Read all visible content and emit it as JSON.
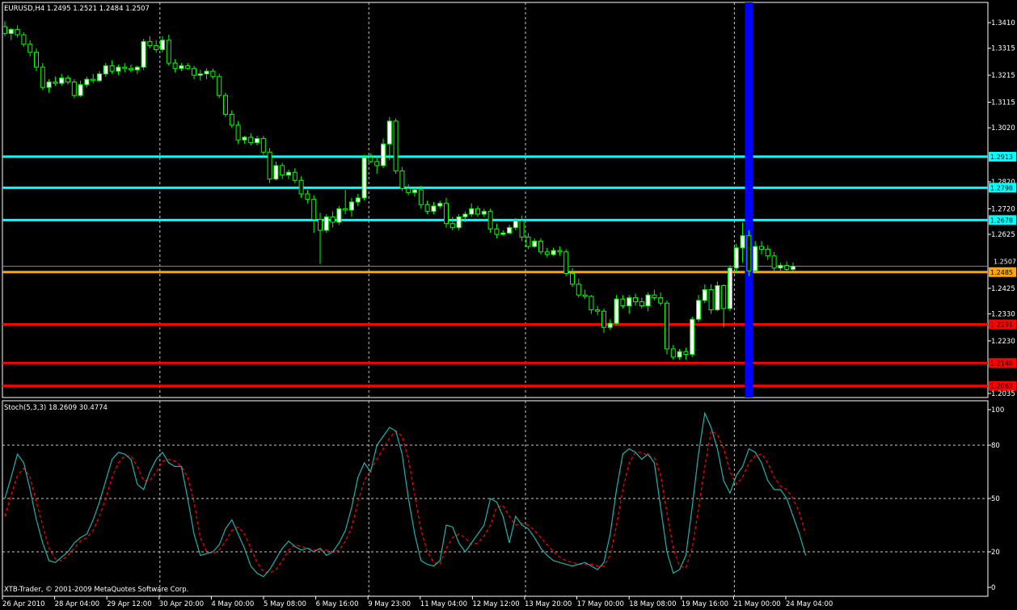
{
  "window": {
    "symbol_title": "EURUSD,H4  1.2495 1.2521 1.2484 1.2507",
    "footer": "XTB-Trader, © 2001-2009 MetaQuotes Software Corp."
  },
  "colors": {
    "background": "#000000",
    "candle_up": "#ffffff",
    "candle_down": "#000000",
    "candle_wick": "#00ff00",
    "grid": "#c8c8c8",
    "resistance": "#00ffff",
    "current": "#ffa500",
    "support": "#ff0000",
    "marker": "#0000ff",
    "stoch_main": "#20b2aa",
    "stoch_signal": "#ff0000"
  },
  "price_axis": {
    "ticks": [
      "1.3410",
      "1.3315",
      "1.3215",
      "1.3115",
      "1.3020",
      "1.2820",
      "1.2720",
      "1.2625",
      "1.2425",
      "1.2330",
      "1.2230",
      "1.2035"
    ],
    "tick_values": [
      1.341,
      1.3315,
      1.3215,
      1.3115,
      1.302,
      1.282,
      1.272,
      1.2625,
      1.2425,
      1.233,
      1.223,
      1.2035
    ],
    "current_label": "1.2507",
    "range": [
      1.202,
      1.3485
    ]
  },
  "levels": [
    {
      "value": 1.2913,
      "label": "1.2913",
      "kind": "resistance"
    },
    {
      "value": 1.2798,
      "label": "1.2798",
      "kind": "resistance"
    },
    {
      "value": 1.2678,
      "label": "1.2678",
      "kind": "resistance"
    },
    {
      "value": 1.2485,
      "label": "1.2485",
      "kind": "current"
    },
    {
      "value": 1.2291,
      "label": "1.2291",
      "kind": "support"
    },
    {
      "value": 1.2148,
      "label": "1.2148",
      "kind": "support"
    },
    {
      "value": 1.2063,
      "label": "1.2063",
      "kind": "support"
    }
  ],
  "time_axis": {
    "labels": [
      "26 Apr 2010",
      "28 Apr 04:00",
      "29 Apr 12:00",
      "30 Apr 20:00",
      "4 May 00:00",
      "5 May 08:00",
      "6 May 16:00",
      "9 May 23:00",
      "11 May 04:00",
      "12 May 12:00",
      "13 May 20:00",
      "17 May 00:00",
      "18 May 08:00",
      "19 May 16:00",
      "21 May 00:00",
      "24 May 04:00"
    ],
    "vertical_grid_at_label": [
      3,
      7,
      10,
      14
    ]
  },
  "marker_bar_index": 118,
  "chart_data": {
    "type": "candlestick",
    "timeframe": "H4",
    "ohlc": [
      [
        1.3395,
        1.3415,
        1.336,
        1.337
      ],
      [
        1.337,
        1.339,
        1.3345,
        1.3385
      ],
      [
        1.3385,
        1.34,
        1.3355,
        1.3365
      ],
      [
        1.3365,
        1.3375,
        1.332,
        1.333
      ],
      [
        1.333,
        1.3345,
        1.3285,
        1.33
      ],
      [
        1.33,
        1.3315,
        1.323,
        1.3245
      ],
      [
        1.3245,
        1.326,
        1.316,
        1.317
      ],
      [
        1.317,
        1.32,
        1.315,
        1.319
      ],
      [
        1.319,
        1.321,
        1.3175,
        1.3185
      ],
      [
        1.3185,
        1.322,
        1.3175,
        1.3205
      ],
      [
        1.3205,
        1.3215,
        1.318,
        1.319
      ],
      [
        1.319,
        1.32,
        1.313,
        1.314
      ],
      [
        1.314,
        1.3195,
        1.3135,
        1.318
      ],
      [
        1.318,
        1.321,
        1.317,
        1.32
      ],
      [
        1.32,
        1.322,
        1.3185,
        1.3195
      ],
      [
        1.3195,
        1.323,
        1.319,
        1.322
      ],
      [
        1.322,
        1.326,
        1.321,
        1.325
      ],
      [
        1.325,
        1.327,
        1.322,
        1.323
      ],
      [
        1.323,
        1.3255,
        1.3215,
        1.3245
      ],
      [
        1.3245,
        1.326,
        1.3225,
        1.324
      ],
      [
        1.324,
        1.3255,
        1.3225,
        1.3235
      ],
      [
        1.3235,
        1.325,
        1.322,
        1.3245
      ],
      [
        1.3245,
        1.335,
        1.3235,
        1.334
      ],
      [
        1.334,
        1.336,
        1.3315,
        1.3325
      ],
      [
        1.3325,
        1.3345,
        1.33,
        1.331
      ],
      [
        1.331,
        1.336,
        1.33,
        1.3345
      ],
      [
        1.3345,
        1.3365,
        1.325,
        1.326
      ],
      [
        1.326,
        1.3275,
        1.3225,
        1.324
      ],
      [
        1.324,
        1.326,
        1.323,
        1.325
      ],
      [
        1.325,
        1.326,
        1.3235,
        1.324
      ],
      [
        1.324,
        1.325,
        1.32,
        1.3215
      ],
      [
        1.3215,
        1.3235,
        1.3195,
        1.322
      ],
      [
        1.322,
        1.324,
        1.32,
        1.323
      ],
      [
        1.323,
        1.324,
        1.32,
        1.321
      ],
      [
        1.321,
        1.322,
        1.313,
        1.314
      ],
      [
        1.314,
        1.315,
        1.306,
        1.307
      ],
      [
        1.307,
        1.3085,
        1.302,
        1.303
      ],
      [
        1.303,
        1.3045,
        1.296,
        1.2975
      ],
      [
        1.2975,
        1.299,
        1.296,
        1.2985
      ],
      [
        1.2985,
        1.3,
        1.2955,
        1.2965
      ],
      [
        1.2965,
        1.299,
        1.2955,
        1.298
      ],
      [
        1.298,
        1.299,
        1.292,
        1.293
      ],
      [
        1.293,
        1.2945,
        1.2815,
        1.283
      ],
      [
        1.283,
        1.2895,
        1.2825,
        1.288
      ],
      [
        1.288,
        1.289,
        1.283,
        1.2845
      ],
      [
        1.2845,
        1.2865,
        1.283,
        1.2855
      ],
      [
        1.2855,
        1.287,
        1.2815,
        1.2825
      ],
      [
        1.2825,
        1.284,
        1.276,
        1.2775
      ],
      [
        1.2775,
        1.279,
        1.274,
        1.2755
      ],
      [
        1.2755,
        1.277,
        1.263,
        1.268
      ],
      [
        1.268,
        1.2705,
        1.2515,
        1.264
      ],
      [
        1.264,
        1.27,
        1.263,
        1.269
      ],
      [
        1.269,
        1.271,
        1.265,
        1.267
      ],
      [
        1.267,
        1.273,
        1.266,
        1.272
      ],
      [
        1.272,
        1.279,
        1.27,
        1.2715
      ],
      [
        1.2715,
        1.276,
        1.269,
        1.2745
      ],
      [
        1.2745,
        1.2775,
        1.273,
        1.276
      ],
      [
        1.276,
        1.292,
        1.275,
        1.291
      ],
      [
        1.291,
        1.2925,
        1.289,
        1.2895
      ],
      [
        1.2895,
        1.2915,
        1.285,
        1.288
      ],
      [
        1.288,
        1.298,
        1.287,
        1.296
      ],
      [
        1.296,
        1.306,
        1.29,
        1.3045
      ],
      [
        1.3045,
        1.3055,
        1.285,
        1.286
      ],
      [
        1.286,
        1.2875,
        1.2785,
        1.2795
      ],
      [
        1.2795,
        1.281,
        1.277,
        1.278
      ],
      [
        1.278,
        1.28,
        1.2765,
        1.279
      ],
      [
        1.279,
        1.2805,
        1.272,
        1.2735
      ],
      [
        1.2735,
        1.275,
        1.27,
        1.271
      ],
      [
        1.271,
        1.2745,
        1.27,
        1.273
      ],
      [
        1.273,
        1.275,
        1.272,
        1.274
      ],
      [
        1.274,
        1.276,
        1.265,
        1.2665
      ],
      [
        1.2665,
        1.269,
        1.264,
        1.265
      ],
      [
        1.265,
        1.27,
        1.264,
        1.269
      ],
      [
        1.269,
        1.271,
        1.267,
        1.27
      ],
      [
        1.27,
        1.274,
        1.269,
        1.272
      ],
      [
        1.272,
        1.273,
        1.269,
        1.27
      ],
      [
        1.27,
        1.272,
        1.269,
        1.271
      ],
      [
        1.271,
        1.272,
        1.263,
        1.2645
      ],
      [
        1.2645,
        1.2665,
        1.261,
        1.2625
      ],
      [
        1.2625,
        1.264,
        1.262,
        1.263
      ],
      [
        1.263,
        1.266,
        1.2625,
        1.265
      ],
      [
        1.265,
        1.2685,
        1.264,
        1.2675
      ],
      [
        1.2675,
        1.2695,
        1.26,
        1.2615
      ],
      [
        1.2615,
        1.263,
        1.257,
        1.258
      ],
      [
        1.258,
        1.261,
        1.2575,
        1.26
      ],
      [
        1.26,
        1.261,
        1.255,
        1.256
      ],
      [
        1.256,
        1.2575,
        1.254,
        1.255
      ],
      [
        1.255,
        1.2575,
        1.2545,
        1.2565
      ],
      [
        1.2565,
        1.258,
        1.2545,
        1.256
      ],
      [
        1.256,
        1.257,
        1.247,
        1.248
      ],
      [
        1.248,
        1.25,
        1.243,
        1.244
      ],
      [
        1.244,
        1.246,
        1.239,
        1.24
      ],
      [
        1.24,
        1.242,
        1.2385,
        1.2395
      ],
      [
        1.2395,
        1.24,
        1.233,
        1.2345
      ],
      [
        1.2345,
        1.236,
        1.2325,
        1.234
      ],
      [
        1.234,
        1.235,
        1.226,
        1.228
      ],
      [
        1.228,
        1.231,
        1.227,
        1.2295
      ],
      [
        1.2295,
        1.24,
        1.229,
        1.2385
      ],
      [
        1.2385,
        1.24,
        1.235,
        1.236
      ],
      [
        1.236,
        1.24,
        1.233,
        1.239
      ],
      [
        1.239,
        1.2405,
        1.236,
        1.2375
      ],
      [
        1.2375,
        1.239,
        1.235,
        1.236
      ],
      [
        1.236,
        1.241,
        1.234,
        1.24
      ],
      [
        1.24,
        1.242,
        1.238,
        1.239
      ],
      [
        1.239,
        1.241,
        1.236,
        1.237
      ],
      [
        1.237,
        1.238,
        1.218,
        1.22
      ],
      [
        1.22,
        1.2215,
        1.216,
        1.217
      ],
      [
        1.217,
        1.22,
        1.216,
        1.219
      ],
      [
        1.219,
        1.2205,
        1.216,
        1.218
      ],
      [
        1.218,
        1.232,
        1.217,
        1.231
      ],
      [
        1.231,
        1.24,
        1.23,
        1.238
      ],
      [
        1.238,
        1.244,
        1.237,
        1.242
      ],
      [
        1.242,
        1.244,
        1.233,
        1.2345
      ],
      [
        1.2345,
        1.245,
        1.234,
        1.2435
      ],
      [
        1.2435,
        1.244,
        1.228,
        1.235
      ],
      [
        1.235,
        1.251,
        1.234,
        1.25
      ],
      [
        1.25,
        1.259,
        1.248,
        1.2575
      ],
      [
        1.2575,
        1.267,
        1.252,
        1.262
      ],
      [
        1.262,
        1.264,
        1.247,
        1.249
      ],
      [
        1.249,
        1.26,
        1.248,
        1.258
      ],
      [
        1.258,
        1.26,
        1.255,
        1.257
      ],
      [
        1.257,
        1.2585,
        1.253,
        1.2545
      ],
      [
        1.2545,
        1.256,
        1.249,
        1.25
      ],
      [
        1.25,
        1.252,
        1.249,
        1.251
      ],
      [
        1.251,
        1.2525,
        1.2485,
        1.2495
      ],
      [
        1.2495,
        1.2521,
        1.2484,
        1.2507
      ]
    ],
    "x_labels": [
      "26 Apr 2010",
      "28 Apr 04:00",
      "29 Apr 12:00",
      "30 Apr 20:00",
      "4 May 00:00",
      "5 May 08:00",
      "6 May 16:00",
      "9 May 23:00",
      "11 May 04:00",
      "12 May 12:00",
      "13 May 20:00",
      "17 May 00:00",
      "18 May 08:00",
      "19 May 16:00",
      "21 May 00:00",
      "24 May 04:00"
    ],
    "y_range": [
      1.202,
      1.3485
    ],
    "stochastic": {
      "title": "Stoch(5,3,3) 18.2609 30.4774",
      "ticks": [
        "100",
        "80",
        "50",
        "20",
        "0"
      ],
      "tick_values": [
        100,
        80,
        50,
        20,
        0
      ],
      "levels": [
        20,
        50,
        80
      ],
      "ylim": [
        -5,
        105
      ],
      "main": [
        50,
        62,
        75,
        70,
        55,
        38,
        25,
        15,
        14,
        17,
        20,
        25,
        28,
        30,
        38,
        48,
        60,
        72,
        76,
        75,
        72,
        58,
        55,
        65,
        72,
        76,
        70,
        68,
        68,
        50,
        30,
        18,
        19,
        20,
        24,
        33,
        38,
        30,
        22,
        12,
        8,
        6,
        10,
        16,
        22,
        26,
        23,
        21,
        22,
        20,
        22,
        18,
        20,
        25,
        32,
        45,
        62,
        70,
        65,
        80,
        85,
        90,
        88,
        75,
        50,
        30,
        15,
        13,
        12,
        15,
        35,
        34,
        25,
        20,
        25,
        30,
        35,
        50,
        48,
        40,
        25,
        40,
        35,
        33,
        28,
        22,
        18,
        15,
        14,
        13,
        12,
        13,
        14,
        12,
        10,
        14,
        30,
        55,
        75,
        78,
        76,
        72,
        75,
        70,
        45,
        20,
        8,
        10,
        18,
        45,
        75,
        98,
        90,
        78,
        60,
        53,
        63,
        68,
        78,
        76,
        70,
        60,
        55,
        55,
        50,
        40,
        30,
        18
      ],
      "signal": [
        40,
        52,
        63,
        67,
        62,
        48,
        35,
        22,
        16,
        15,
        18,
        22,
        26,
        28,
        32,
        40,
        50,
        62,
        70,
        74,
        74,
        68,
        60,
        60,
        65,
        71,
        72,
        71,
        68,
        62,
        48,
        28,
        20,
        19,
        21,
        26,
        32,
        34,
        30,
        22,
        14,
        9,
        8,
        10,
        15,
        21,
        24,
        23,
        22,
        21,
        21,
        21,
        20,
        21,
        26,
        34,
        48,
        60,
        66,
        72,
        78,
        84,
        88,
        85,
        72,
        52,
        32,
        20,
        14,
        13,
        22,
        28,
        30,
        28,
        24,
        25,
        29,
        35,
        45,
        46,
        40,
        35,
        36,
        35,
        32,
        28,
        24,
        20,
        17,
        15,
        14,
        13,
        13,
        13,
        12,
        12,
        18,
        35,
        55,
        70,
        76,
        76,
        74,
        73,
        63,
        42,
        22,
        12,
        11,
        22,
        44,
        68,
        88,
        86,
        78,
        65,
        58,
        62,
        70,
        74,
        75,
        70,
        62,
        57,
        55,
        50,
        42,
        30
      ]
    }
  }
}
